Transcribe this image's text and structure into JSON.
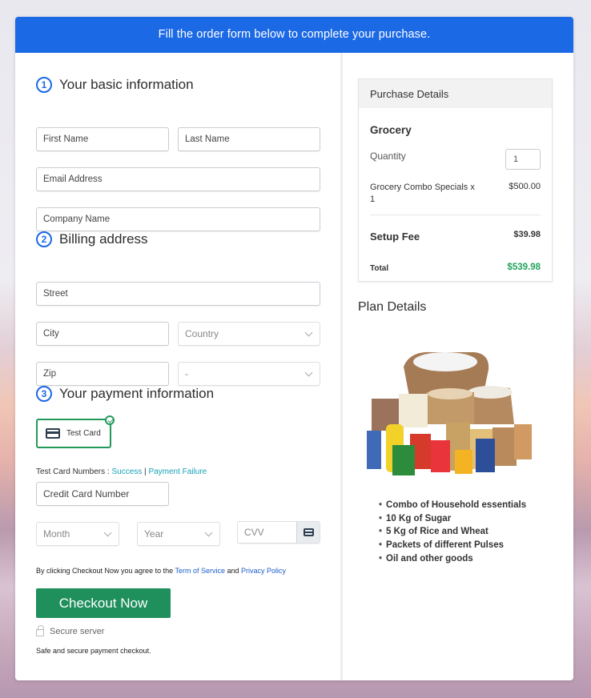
{
  "banner": {
    "text": "Fill the order form below to complete your purchase."
  },
  "sections": {
    "basic": {
      "number": "1",
      "title": "Your basic information"
    },
    "billing": {
      "number": "2",
      "title": "Billing address"
    },
    "payment": {
      "number": "3",
      "title": "Your payment information"
    }
  },
  "fields": {
    "first_name": "First Name",
    "last_name": "Last Name",
    "email": "Email Address",
    "company": "Company Name",
    "street": "Street",
    "city": "City",
    "country": "Country",
    "zip": "Zip",
    "state": "-",
    "card_number": "Credit Card Number",
    "month": "Month",
    "year": "Year",
    "cvv": "CVV"
  },
  "payment": {
    "method_label": "Test Card",
    "test_numbers_label": "Test Card Numbers : ",
    "success_link": "Success",
    "separator": " | ",
    "failure_link": "Payment Failure"
  },
  "terms": {
    "prefix": "By clicking Checkout Now you agree to the ",
    "tos_link": "Term of Service",
    "and": " and ",
    "privacy_link": "Privacy Policy"
  },
  "checkout": {
    "button_label": "Checkout Now",
    "secure_label": "Secure server",
    "safe_text": "Safe and secure payment checkout."
  },
  "purchase": {
    "header": "Purchase Details",
    "product": "Grocery",
    "quantity_label": "Quantity",
    "quantity_value": "1",
    "item_name": "Grocery Combo Specials x 1",
    "item_price": "$500.00",
    "setup_label": "Setup Fee",
    "setup_price": "$39.98",
    "total_label": "Total",
    "total_price": "$539.98"
  },
  "plan": {
    "title": "Plan Details",
    "image_alt": "grocery-products-image",
    "items": [
      "Combo of Household essentials",
      "10 Kg of Sugar",
      "5 Kg of Rice and Wheat",
      "Packets of different Pulses",
      "Oil and other goods"
    ]
  }
}
